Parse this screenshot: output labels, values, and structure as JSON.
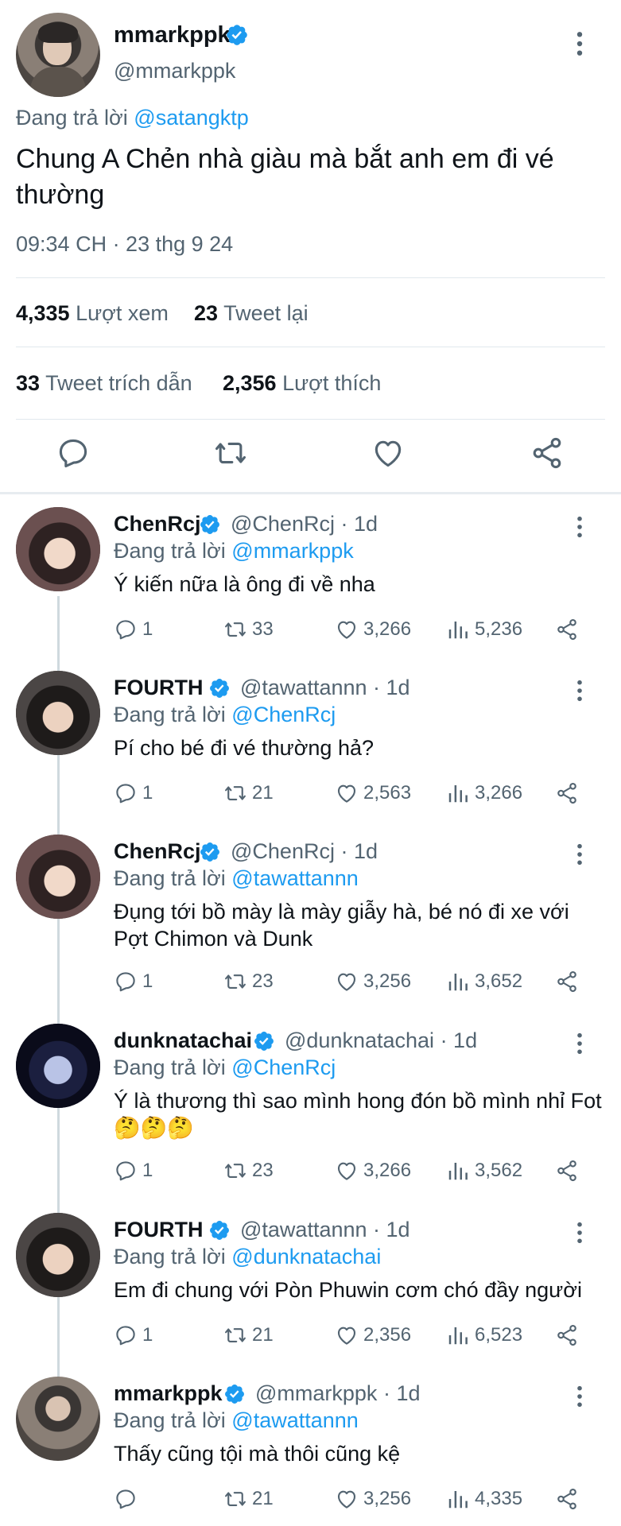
{
  "main_tweet": {
    "display_name": "mmarkppk",
    "handle": "@mmarkppk",
    "reply_prefix": "Đang trả lời",
    "reply_to": "@satangktp",
    "text": "Chung A Chẻn nhà giàu mà bắt anh em đi vé thường",
    "timestamp": "09:34 CH · 23 thg 9 24",
    "stats": {
      "views_count": "4,335",
      "views_label": "Lượt xem",
      "retweets_count": "23",
      "retweets_label": "Tweet lại",
      "quotes_count": "33",
      "quotes_label": "Tweet trích dẫn",
      "likes_count": "2,356",
      "likes_label": "Lượt thích"
    },
    "actions": [
      "reply-icon",
      "retweet-icon",
      "like-icon",
      "share-icon"
    ]
  },
  "colors": {
    "link": "#1d9bf0",
    "verified": "#1d9bf0",
    "secondary_text": "#536471",
    "primary_text": "#0f1419",
    "divider": "#e1e8ed"
  },
  "replies": [
    {
      "display_name": "ChenRcj",
      "handle": "@ChenRcj",
      "age": "· 1d",
      "reply_prefix": "Đang trả lời",
      "reply_to": "@mmarkppk",
      "text": "Ý kiến nữa là ông đi về nha",
      "replies": "1",
      "retweets": "33",
      "likes": "3,266",
      "views": "5,236"
    },
    {
      "display_name": "FOURTH",
      "handle": "@tawattannn",
      "age": "· 1d",
      "reply_prefix": "Đang trả lời",
      "reply_to": "@ChenRcj",
      "text": "Pí cho bé đi vé thường hả?",
      "replies": "1",
      "retweets": "21",
      "likes": "2,563",
      "views": "3,266"
    },
    {
      "display_name": "ChenRcj",
      "handle": "@ChenRcj",
      "age": "· 1d",
      "reply_prefix": "Đang trả lời",
      "reply_to": "@tawattannn",
      "text": "Đụng tới bồ mày là mày giẫy hà, bé nó đi xe với Pợt Chimon và Dunk",
      "replies": "1",
      "retweets": "23",
      "likes": "3,256",
      "views": "3,652"
    },
    {
      "display_name": "dunknatachai",
      "handle": "@dunknatachai",
      "age": "· 1d",
      "reply_prefix": "Đang trả lời",
      "reply_to": "@ChenRcj",
      "text": "Ý là thương thì sao mình hong đón bồ mình nhỉ Fot🤔🤔🤔",
      "replies": "1",
      "retweets": "23",
      "likes": "3,266",
      "views": "3,562"
    },
    {
      "display_name": "FOURTH",
      "handle": "@tawattannn",
      "age": "· 1d",
      "reply_prefix": "Đang trả lời",
      "reply_to": "@dunknatachai",
      "text": "Em đi chung với Pòn Phuwin cơm chó đầy người",
      "replies": "1",
      "retweets": "21",
      "likes": "2,356",
      "views": "6,523"
    },
    {
      "display_name": "mmarkppk",
      "handle": "@mmarkppk",
      "age": "· 1d",
      "reply_prefix": "Đang trả lời",
      "reply_to": "@tawattannn",
      "text": "Thấy cũng tội mà thôi cũng kệ",
      "replies": "",
      "retweets": "21",
      "likes": "3,256",
      "views": "4,335"
    }
  ]
}
